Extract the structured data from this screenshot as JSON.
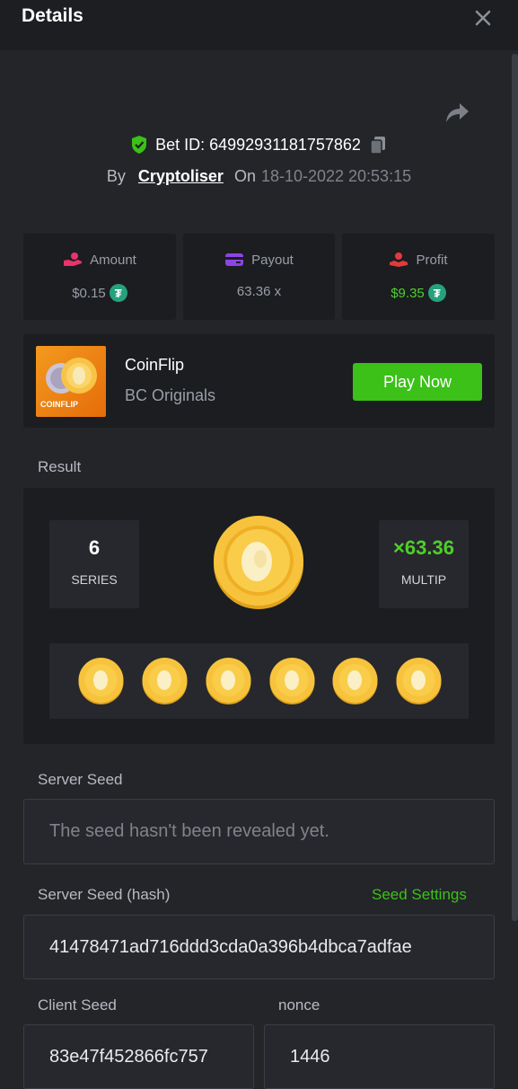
{
  "header": {
    "title": "Details"
  },
  "bet": {
    "id_label": "Bet ID: 64992931181757862",
    "by_label": "By",
    "user": "Cryptoliser",
    "on_label": "On",
    "datetime": "18-10-2022 20:53:15"
  },
  "stats": {
    "amount": {
      "label": "Amount",
      "value": "$0.15"
    },
    "payout": {
      "label": "Payout",
      "value": "63.36 x"
    },
    "profit": {
      "label": "Profit",
      "value": "$9.35"
    }
  },
  "game": {
    "thumb_text": "COINFLIP",
    "name": "CoinFlip",
    "provider": "BC Originals",
    "play_label": "Play Now"
  },
  "result": {
    "label": "Result",
    "series_value": "6",
    "series_label": "SERIES",
    "multiplier_value": "×63.36",
    "multiplier_label": "MULTIP",
    "coins": [
      "coin",
      "coin",
      "coin",
      "coin",
      "coin",
      "coin"
    ]
  },
  "server_seed": {
    "label": "Server Seed",
    "value": "The seed hasn't been revealed yet."
  },
  "server_seed_hash": {
    "label": "Server Seed (hash)",
    "settings_link": "Seed Settings",
    "value": "41478471ad716ddd3cda0a396b4dbca7adfae"
  },
  "client_seed": {
    "label": "Client Seed",
    "value": "83e47f452866fc757"
  },
  "nonce": {
    "label": "nonce",
    "value": "1446"
  },
  "colors": {
    "accent_green": "#3bc117",
    "tether": "#26a17b",
    "profit_icon": "#e23b3b",
    "payout_icon": "#8e43e6",
    "amount_icon": "#e8336b"
  }
}
